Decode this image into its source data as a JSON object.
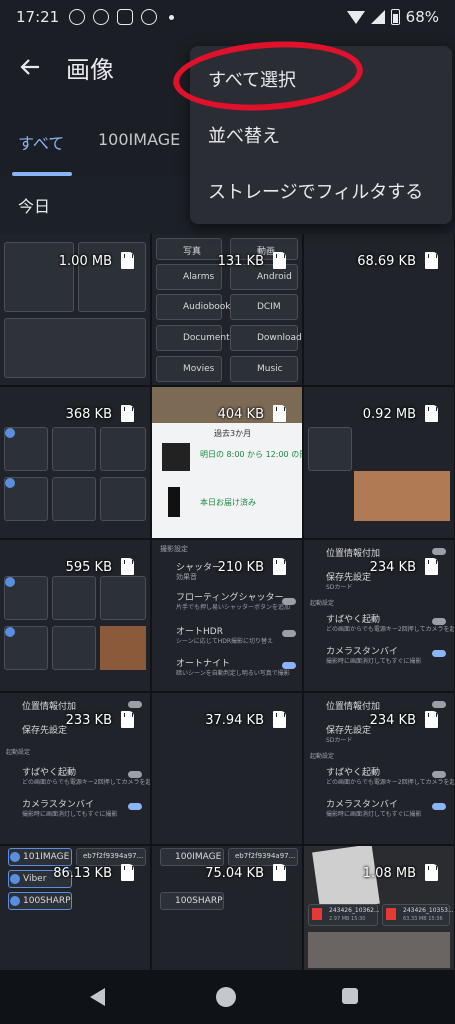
{
  "status_bar": {
    "time": "17:21",
    "battery": "68%",
    "notif_icons": [
      "line-icon",
      "circle-icon",
      "clipboard-icon",
      "d-app-icon"
    ]
  },
  "app_bar": {
    "title": "画像",
    "back_icon": "arrow-left-icon"
  },
  "tabs": {
    "items": [
      {
        "label": "すべて",
        "active": true
      },
      {
        "label": "100IMAGE",
        "active": false
      }
    ]
  },
  "section": {
    "label": "今日"
  },
  "menu": {
    "items": [
      "すべて選択",
      "並べ替え",
      "ストレージでフィルタする"
    ]
  },
  "grid": {
    "sizes": [
      "1.00 MB",
      "131 KB",
      "68.69 KB",
      "368 KB",
      "404 KB",
      "0.92 MB",
      "595 KB",
      "210 KB",
      "234 KB",
      "233 KB",
      "37.94 KB",
      "234 KB",
      "86.13 KB",
      "75.04 KB",
      "1.08 MB"
    ],
    "storage_icon": "sd-card-icon"
  },
  "thumb_text": {
    "folders": [
      "写真",
      "動画",
      "Alarms",
      "Android",
      "Audiobooks",
      "DCIM",
      "Documents",
      "Download",
      "Movies",
      "Music"
    ],
    "delivery": {
      "header": "過去3か月",
      "row1": "明日の 8:00 から 12:00 の間にお届け",
      "row2": "本日お届け済み"
    },
    "camera": {
      "section": "撮影設定",
      "shutter": "シャッター",
      "shutter_sub": "効果音",
      "floating": "フローティングシャッター",
      "floating_sub": "片手でも押し易いシャッターボタンを追加",
      "hdr": "オートHDR",
      "hdr_sub": "シーンに応じてHDR撮影に切り替え",
      "night": "オートナイト",
      "night_sub": "暗いシーンを自動判定し明るい写真で撮影"
    },
    "settings": {
      "location": "位置情報付加",
      "save": "保存先設定",
      "save_sub": "SDカード",
      "startup": "起動設定",
      "quick": "すばやく起動",
      "quick_sub": "どの画面からでも電源キー2回押してカメラを起動",
      "standby": "カメラスタンバイ",
      "standby_sub": "撮影時に画面消灯してもすぐに撮影"
    },
    "folders2": [
      "101IMAGE",
      "eb7f2f9394a97...",
      "Viber",
      "100SHARP"
    ],
    "folders3": [
      "100IMAGE",
      "eb7f2f9394a97...",
      "100SHARP"
    ],
    "files": [
      "243426_10362...",
      "243426_10353...",
      "2.97 MB 15:30",
      "63.33 MB 15:36"
    ]
  },
  "nav": {
    "back": "nav-back-icon",
    "home": "nav-home-icon",
    "recent": "nav-recent-icon"
  },
  "colors": {
    "accent": "#8ab4f8",
    "annotation": "#e0112b",
    "background": "#0f1317"
  }
}
